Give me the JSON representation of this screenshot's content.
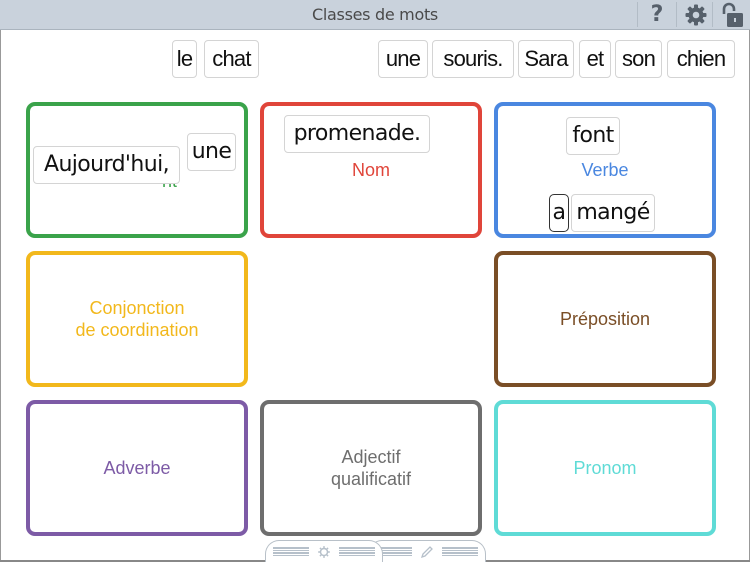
{
  "header": {
    "title": "Classes de mots",
    "buttons": [
      {
        "name": "help",
        "icon": "question-mark-icon",
        "glyph": "?"
      },
      {
        "name": "settings",
        "icon": "gear-icon"
      },
      {
        "name": "lock",
        "icon": "unlocked-padlock-icon"
      }
    ]
  },
  "word_bank": {
    "tiles": [
      "le",
      "chat",
      "une",
      "souris.",
      "Sara",
      "et",
      "son",
      "chien"
    ]
  },
  "categories": [
    {
      "label": "Déterminant",
      "visible_label_fragment": "nt",
      "color": "#3aa34a",
      "tiles": [
        "Aujourd'hui,",
        "une"
      ]
    },
    {
      "label": "Nom",
      "color": "#e0453a",
      "tiles": [
        "promenade."
      ]
    },
    {
      "label": "Verbe",
      "color": "#4a87e0",
      "tiles": [
        "font",
        "a",
        "mangé"
      ],
      "selected_tile": "a"
    },
    {
      "label": "Conjonction\nde coordination",
      "color": "#f2b81c",
      "tiles": []
    },
    {
      "label": "Préposition",
      "color": "#7a4e26",
      "tiles": []
    },
    {
      "label": "Adverbe",
      "color": "#7d5ba6",
      "tiles": []
    },
    {
      "label": "Adjectif\nqualificatif",
      "color": "#6e6e6e",
      "tiles": []
    },
    {
      "label": "Pronom",
      "color": "#5fdbd6",
      "tiles": []
    }
  ],
  "bottom_tabs": [
    {
      "name": "settings-tab",
      "icon": "gear-icon"
    },
    {
      "name": "edit-tab",
      "icon": "pencil-icon"
    }
  ]
}
